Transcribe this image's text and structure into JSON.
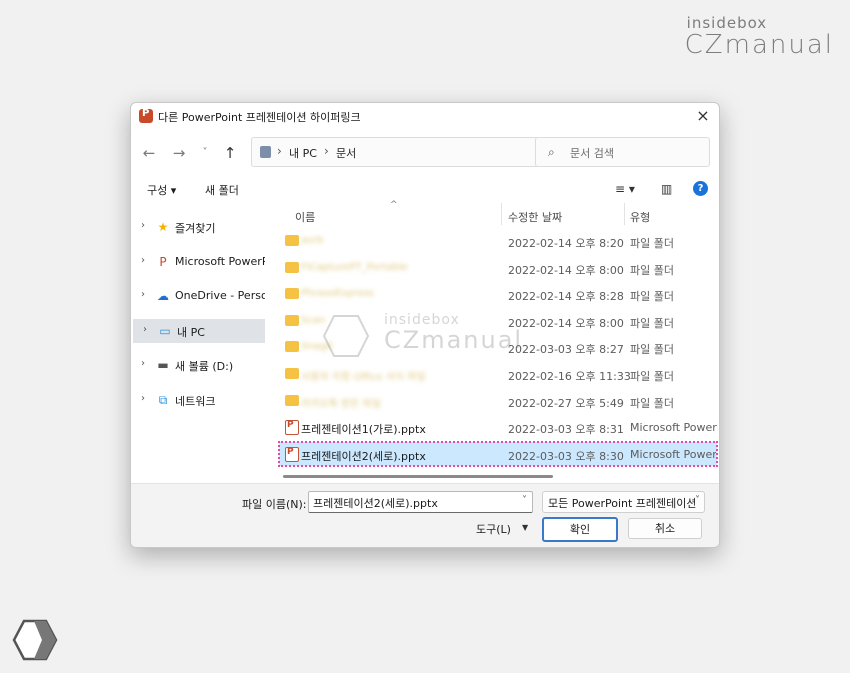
{
  "brand": {
    "small": "insidebox",
    "big": "CZmanual"
  },
  "watermark": {
    "small": "insidebox",
    "big": "CZmanual"
  },
  "dialog": {
    "title": "다른 PowerPoint 프레젠테이션 하이퍼링크",
    "close_icon": "×"
  },
  "nav": {
    "back_icon": "←",
    "forward_icon": "→",
    "recent_icon": "˅",
    "up_icon": "↑",
    "breadcrumb": [
      "내 PC",
      "문서"
    ],
    "refresh_icon": "↻",
    "search_placeholder": "문서 검색"
  },
  "toolbar": {
    "organize": "구성 ▾",
    "new_folder": "새 폴더",
    "view_icon": "≡ ▾",
    "pane_icon": "▥",
    "help_icon": "?"
  },
  "sidebar": {
    "items": [
      {
        "label": "즐겨찾기",
        "icon": "star-icon",
        "glyph": "★",
        "color": "#f2b400"
      },
      {
        "label": "Microsoft PowerPoi",
        "icon": "powerpoint-icon",
        "glyph": "P",
        "color": "#c94a2a"
      },
      {
        "label": "OneDrive - Persona",
        "icon": "cloud-icon",
        "glyph": "☁",
        "color": "#1f6fd1"
      },
      {
        "label": "내 PC",
        "icon": "computer-icon",
        "glyph": "▭",
        "color": "#2a8fd8",
        "active": true
      },
      {
        "label": "새 볼륨 (D:)",
        "icon": "drive-icon",
        "glyph": "▬",
        "color": "#555555"
      },
      {
        "label": "네트워크",
        "icon": "network-icon",
        "glyph": "⧉",
        "color": "#2a8fd8"
      }
    ]
  },
  "filelist": {
    "headers": {
      "name": "이름",
      "date": "수정한 날짜",
      "type": "유형"
    },
    "rows": [
      {
        "name": "avrb",
        "date": "2022-02-14 오후 8:20",
        "type": "파일 폴더",
        "kind": "folder",
        "blurred": true
      },
      {
        "name": "FICapturePT_Portable",
        "date": "2022-02-14 오후 8:00",
        "type": "파일 폴더",
        "kind": "folder",
        "blurred": true
      },
      {
        "name": "PhraseExpress",
        "date": "2022-02-14 오후 8:28",
        "type": "파일 폴더",
        "kind": "folder",
        "blurred": true
      },
      {
        "name": "Scan",
        "date": "2022-02-14 오후 8:00",
        "type": "파일 폴더",
        "kind": "folder",
        "blurred": true
      },
      {
        "name": "Snagit",
        "date": "2022-03-03 오후 8:27",
        "type": "파일 폴더",
        "kind": "folder",
        "blurred": true
      },
      {
        "name": "사용자 지정 Office 서식 파일",
        "date": "2022-02-16 오후 11:33",
        "type": "파일 폴더",
        "kind": "folder",
        "blurred": true
      },
      {
        "name": "카카오톡 받은 파일",
        "date": "2022-02-27 오후 5:49",
        "type": "파일 폴더",
        "kind": "folder",
        "blurred": true
      },
      {
        "name": "프레젠테이션1(가로).pptx",
        "date": "2022-03-03 오후 8:31",
        "type": "Microsoft PowerP...",
        "kind": "pptx",
        "blurred": false
      },
      {
        "name": "프레젠테이션2(세로).pptx",
        "date": "2022-03-03 오후 8:30",
        "type": "Microsoft PowerP...",
        "kind": "pptx",
        "blurred": false,
        "selected": true
      }
    ]
  },
  "bottom": {
    "filename_label": "파일 이름(N):",
    "filename_value": "프레젠테이션2(세로).pptx",
    "filetype_value": "모든 PowerPoint 프레젠테이션",
    "tools_label": "도구(L)",
    "ok_label": "확인",
    "cancel_label": "취소"
  }
}
